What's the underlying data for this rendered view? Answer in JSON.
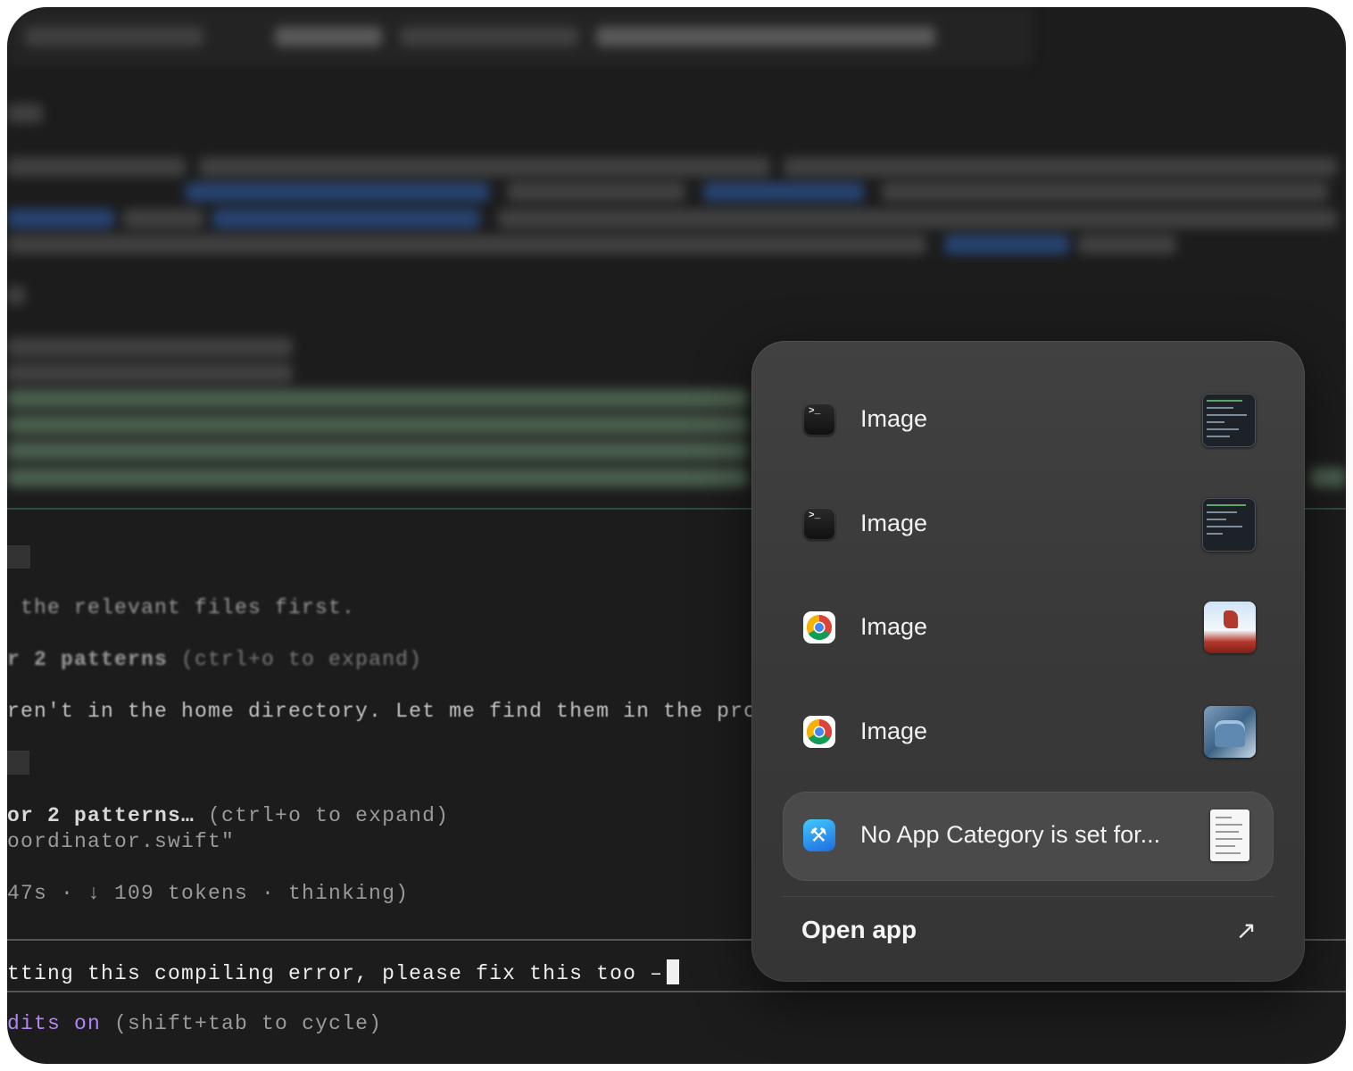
{
  "terminal": {
    "lines": [
      {
        "prefix": "",
        "text": " the relevant files first.",
        "hint": ""
      },
      {
        "prefix": "r 2 patterns",
        "text": "",
        "hint": " (ctrl+o to expand)"
      },
      {
        "prefix": "",
        "text": "ren't in the home directory. Let me find them in the proje",
        "hint": ""
      },
      {
        "prefix": "or 2 patterns…",
        "text": "",
        "hint": " (ctrl+o to expand)"
      },
      {
        "prefix": "",
        "text": "oordinator.swift\"",
        "hint": ""
      },
      {
        "prefix": "",
        "text": "47s · ↓ 109 tokens · thinking)",
        "hint": ""
      }
    ],
    "prompt_text": "tting this compiling error, please fix this too –",
    "status_mode": "dits on",
    "status_hint": " (shift+tab to cycle)"
  },
  "switcher": {
    "items": [
      {
        "app_icon": "terminal-icon",
        "label": "Image",
        "thumbnail": "terminal-screenshot-thumbnail"
      },
      {
        "app_icon": "terminal-icon",
        "label": "Image",
        "thumbnail": "terminal-screenshot-thumbnail"
      },
      {
        "app_icon": "chrome-icon",
        "label": "Image",
        "thumbnail": "red-sculpture-thumbnail"
      },
      {
        "app_icon": "chrome-icon",
        "label": "Image",
        "thumbnail": "blue-chair-thumbnail"
      },
      {
        "app_icon": "xcode-icon",
        "label": "No App Category is set for...",
        "thumbnail": "document-thumbnail",
        "selected": true
      }
    ],
    "open_app_label": "Open app",
    "open_app_icon": "arrow-up-right-icon"
  },
  "colors": {
    "terminal_bg": "#1c1c1c",
    "popup_bg": "#3a3a3a",
    "selected_row_bg": "#4a4a4a",
    "accent_purple": "#b185f5"
  }
}
